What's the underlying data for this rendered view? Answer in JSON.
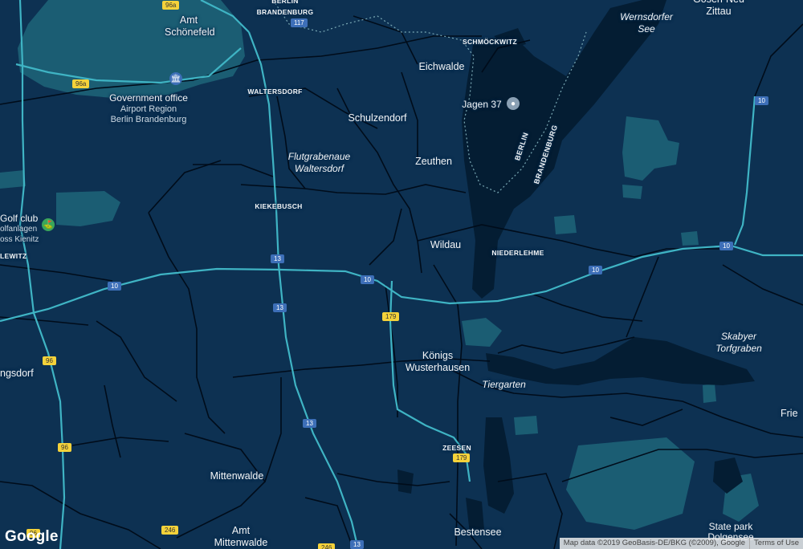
{
  "map": {
    "towns": {
      "amt_schoenefeld": "Amt\nSchönefeld",
      "eichwalde": "Eichwalde",
      "schulzendorf": "Schulzendorf",
      "zeuthen": "Zeuthen",
      "wildau": "Wildau",
      "koenigs_wusterhausen": "Königs\nWusterhausen",
      "mittenwalde": "Mittenwalde",
      "amt_mittenwalde": "Amt\nMittenwalde",
      "bestensee": "Bestensee",
      "gosen_neu_zittau": "Gosen-Neu\nZittau",
      "ngsdorf": "ngsdorf",
      "frie": "Frie"
    },
    "small_places": {
      "brandenburg": "BRANDENBURG",
      "berlin": "BERLIN",
      "schmoeckwitz": "SCHMÖCKWITZ",
      "waltersdorf": "WALTERSDORF",
      "kiekebusch": "KIEKEBUSCH",
      "niederlehme": "NIEDERLEHME",
      "zeesen": "ZEESEN",
      "lewitz": "LEWITZ"
    },
    "boundary_labels": {
      "berlin": "BERLIN",
      "brandenburg": "BRANDENBURG"
    },
    "natural": {
      "wernsdorfer_see": "Wernsdorfer\nSee",
      "flutgrabenaue": "Flutgrabenaue\nWaltersdorf",
      "skabyer": "Skabyer\nTorfgraben",
      "tiergarten": "Tiergarten"
    },
    "pois": {
      "government_office": "Government office",
      "airport_region": "Airport Region\nBerlin Brandenburg",
      "jagen_37": "Jagen 37",
      "golf_club": "Golf club",
      "golfanlagen": "olfanlagen\noss Kienitz",
      "state_park": "State park\nDolgensee"
    },
    "shields": {
      "r96a_top": "96a",
      "r96a": "96a",
      "r117": "117",
      "a10_ne": "10",
      "a10_e": "10",
      "a10_mid": "10",
      "a10_center": "10",
      "a10_w": "10",
      "a13_n": "13",
      "a13_mid": "13",
      "a13_s": "13",
      "a13_bottom": "13",
      "r179_n": "179",
      "r179_s": "179",
      "r96_n": "96",
      "r96_s": "96",
      "r96_bottom": "96",
      "r246": "246",
      "r246b": "246"
    },
    "icons": {
      "government": "government-building-icon",
      "pin": "map-pin-icon",
      "golf": "golf-icon"
    }
  },
  "colors": {
    "background": "#0d3152",
    "water": "#041d33",
    "park": "#1b5d73",
    "road": "#000c1a",
    "highway": "#3fb4c4"
  },
  "google_logo": "Google",
  "attribution": {
    "map_data": "Map data ©2019 GeoBasis-DE/BKG (©2009), Google",
    "terms": "Terms of Use"
  }
}
